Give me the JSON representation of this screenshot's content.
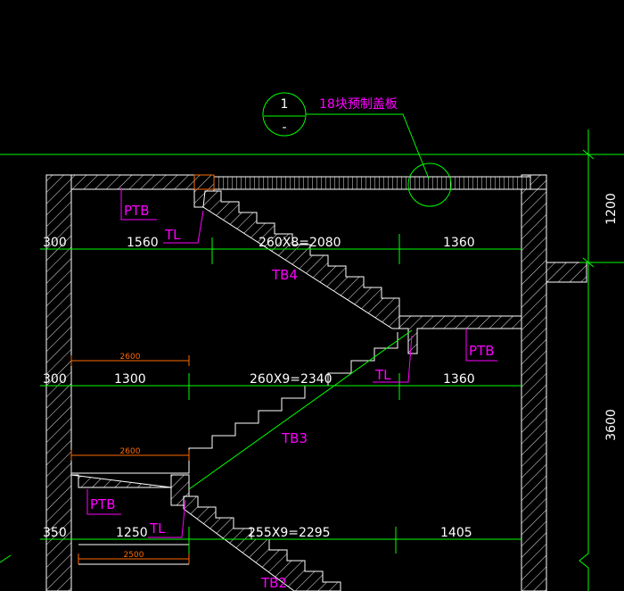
{
  "colors": {
    "background": "#000000",
    "wall": "#ffffff",
    "dimension": "#00ff00",
    "label": "#ff00ff",
    "dim_small": "#ff6a00",
    "text": "#ffffff"
  },
  "callout": {
    "number": "1",
    "sub": "-",
    "note": "18块预制盖板"
  },
  "right_dims": {
    "upper": "1200",
    "lower": "3600"
  },
  "labels": {
    "ptb": "PTB",
    "tl": "TL",
    "tb4": "TB4",
    "tb3": "TB3",
    "tb2": "TB2"
  },
  "row1": {
    "a": "300",
    "b": "1560",
    "c": "260X8=2080",
    "d": "1360"
  },
  "row2": {
    "a": "300",
    "b": "1300",
    "c": "260X9=2340",
    "d": "1360"
  },
  "row3": {
    "a": "350",
    "b": "1250",
    "c": "255X9=2295",
    "d": "1405"
  },
  "small_dims": {
    "d1": "2600",
    "d2": "2600",
    "d3": "2500"
  }
}
